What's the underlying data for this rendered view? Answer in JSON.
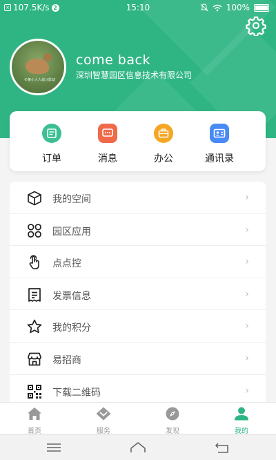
{
  "status": {
    "speed": "107.5K/s",
    "time": "15:10",
    "battery": "100%"
  },
  "profile": {
    "greeting": "come back",
    "company": "深圳智慧园区信息技术有限公司",
    "avatar_watermark": "©某小人人战斗影动"
  },
  "quick_actions": [
    {
      "label": "订单",
      "icon": "order-icon",
      "color": "#3dbf94"
    },
    {
      "label": "消息",
      "icon": "message-icon",
      "color": "#f06a4a"
    },
    {
      "label": "办公",
      "icon": "briefcase-icon",
      "color": "#f5a623"
    },
    {
      "label": "通讯录",
      "icon": "contacts-icon",
      "color": "#4a8af4"
    }
  ],
  "menu": [
    {
      "label": "我的空间",
      "icon": "cube-icon"
    },
    {
      "label": "园区应用",
      "icon": "apps-icon"
    },
    {
      "label": "点点控",
      "icon": "hand-pointer-icon"
    },
    {
      "label": "发票信息",
      "icon": "invoice-icon"
    },
    {
      "label": "我的积分",
      "icon": "star-icon"
    },
    {
      "label": "易招商",
      "icon": "store-icon"
    },
    {
      "label": "下载二维码",
      "icon": "qrcode-icon"
    }
  ],
  "chevron": "›",
  "tabs": [
    {
      "label": "首页",
      "icon": "home-icon"
    },
    {
      "label": "服务",
      "icon": "service-icon"
    },
    {
      "label": "发现",
      "icon": "compass-icon"
    },
    {
      "label": "我的",
      "icon": "user-icon",
      "active": true
    }
  ],
  "colors": {
    "accent": "#2fb584",
    "inactive": "#999999"
  }
}
